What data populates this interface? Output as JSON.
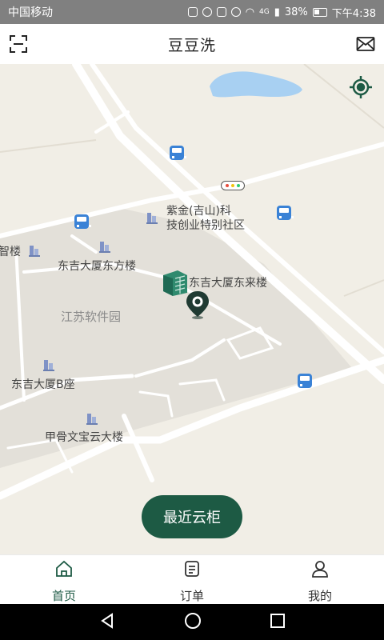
{
  "status_bar": {
    "carrier": "中国移动",
    "network": "4G",
    "battery": "38%",
    "time": "下午4:38"
  },
  "header": {
    "title": "豆豆洗",
    "left_icon": "scan-icon",
    "right_icon": "mail-icon"
  },
  "map": {
    "labels": {
      "zijin_line1": "紫金(吉山)科",
      "zijin_line2": "技创业特别社区",
      "zhilou": "智楼",
      "dongfang": "东吉大厦东方楼",
      "donglai": "东吉大厦东来楼",
      "ruanjianyuan": "江苏软件园",
      "bzuo": "东吉大厦B座",
      "jiagu": "甲骨文宝云大楼"
    },
    "water_color": "#a8d0f2",
    "land_color": "#f1eee6",
    "block_color": "#e3e0d9"
  },
  "nearest_button": "最近云柜",
  "tabs": [
    {
      "label": "首页",
      "icon": "home-icon",
      "active": true
    },
    {
      "label": "订单",
      "icon": "order-list-icon",
      "active": false
    },
    {
      "label": "我的",
      "icon": "user-icon",
      "active": false
    }
  ],
  "colors": {
    "brand": "#1d5a44",
    "pin": "#1f3a32"
  }
}
